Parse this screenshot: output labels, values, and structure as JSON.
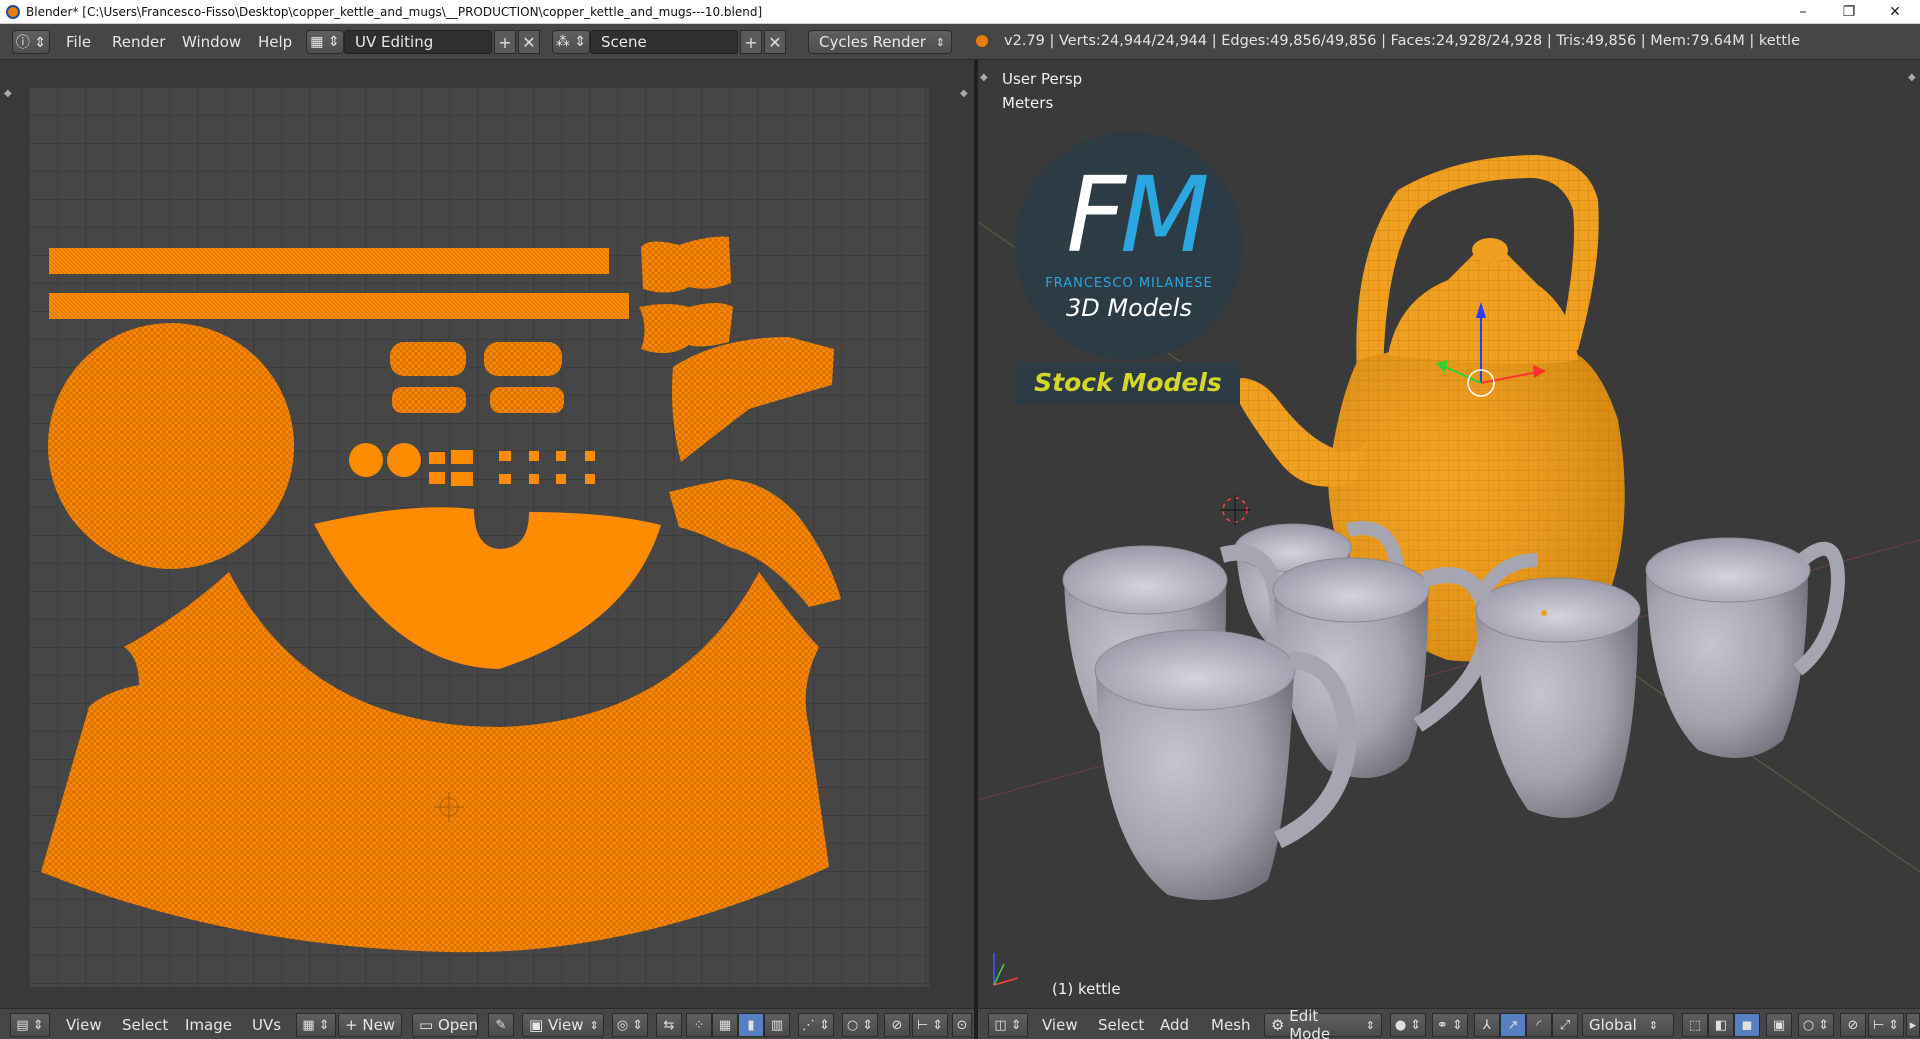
{
  "titlebar": {
    "title": "Blender* [C:\\Users\\Francesco-Fisso\\Desktop\\copper_kettle_and_mugs\\__PRODUCTION\\copper_kettle_and_mugs---10.blend]",
    "minimize": "–",
    "maximize": "❐",
    "close": "✕"
  },
  "infobar": {
    "menus": [
      "File",
      "Render",
      "Window",
      "Help"
    ],
    "screen_layout": "UV Editing",
    "scene": "Scene",
    "render_engine": "Cycles Render",
    "stats": "v2.79 | Verts:24,944/24,944 | Edges:49,856/49,856 | Faces:24,928/24,928 | Tris:49,856 | Mem:79.64M | kettle"
  },
  "viewport": {
    "view_label": "User Persp",
    "units_label": "Meters",
    "object_label": "(1) kettle"
  },
  "logo": {
    "f": "F",
    "m": "M",
    "name": "FRANCESCO MILANESE",
    "sub": "3D Models",
    "stock": "Stock Models"
  },
  "uv_header": {
    "menus": [
      "View",
      "Select",
      "Image",
      "UVs"
    ],
    "new_label": "New",
    "open_label": "Open",
    "view_label": "View"
  },
  "view3d_header": {
    "menus": [
      "View",
      "Select",
      "Add",
      "Mesh"
    ],
    "mode": "Edit Mode",
    "orientation": "Global"
  },
  "colors": {
    "uv_orange": "#ff8c00",
    "mesh_orange": "#f5a016",
    "mug_grey": "#a9a9b4",
    "accent_blue": "#5680c2"
  }
}
